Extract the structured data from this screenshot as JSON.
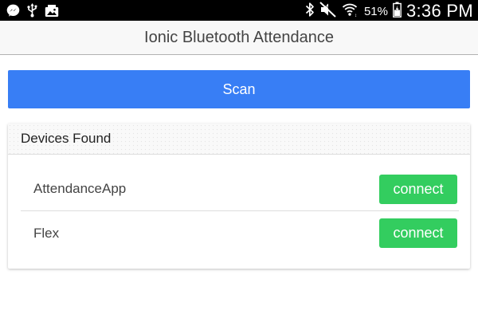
{
  "status_bar": {
    "left_icons": [
      "messenger-icon",
      "usb-icon",
      "gallery-icon"
    ],
    "right_icons": [
      "bluetooth-icon",
      "mute-icon",
      "wifi-icon",
      "battery-icon"
    ],
    "battery_percent": "51%",
    "time": "3:36 PM"
  },
  "header": {
    "title": "Ionic Bluetooth Attendance"
  },
  "scan_button": {
    "label": "Scan",
    "color": "#387ef5"
  },
  "devices_card": {
    "title": "Devices Found",
    "devices": [
      {
        "name": "AttendanceApp",
        "action_label": "connect"
      },
      {
        "name": "Flex",
        "action_label": "connect"
      }
    ],
    "action_color": "#33cd5f"
  }
}
